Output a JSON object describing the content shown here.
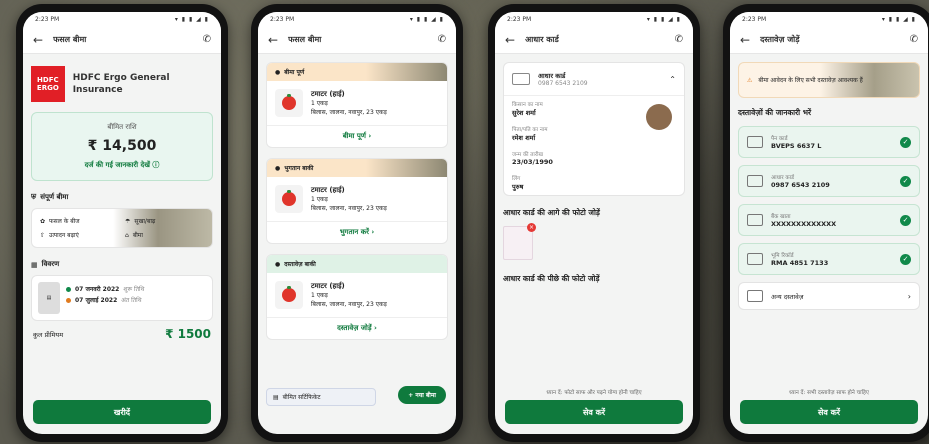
{
  "status": {
    "time": "2:23 PM",
    "icons": "▾ ▮ ▮ ◢ ▮"
  },
  "phone1": {
    "title": "फसल बीमा",
    "insurer_name": "HDFC Ergo General Insurance",
    "logo_text": "HDFC ERGO",
    "premium_label": "बीमित राशि",
    "premium_amount": "₹ 14,500",
    "premium_link": "दर्ज की गई जानकारी देखें ⓘ",
    "coverage_title": "संपूर्ण बीमा",
    "benefits": [
      "फसल के बीज",
      "सूखा/बाढ़",
      "उत्पादन बढ़ाएं",
      "बीमा"
    ],
    "timeline_title": "विवरण",
    "timeline": [
      {
        "date": "07 जनवरी 2022",
        "tag": "शुरू तिथि"
      },
      {
        "date": "07 जुलाई 2022",
        "tag": "अंत तिथि"
      }
    ],
    "total_label": "कुल प्रीमियम",
    "total_amount": "₹ 1500",
    "cta": "खरीदें"
  },
  "phone2": {
    "title": "फसल बीमा",
    "crops": [
      {
        "banner": "बीमा पूर्ण",
        "banner_color": "#fbe5c8",
        "name": "टमाटर (हाई)",
        "area": "1 एकड़",
        "location": "बिलास, जालना, नवापुर, 23 एकड़",
        "link": "बीमा पूर्ण ›"
      },
      {
        "banner": "भुगतान बाकी",
        "banner_color": "#fbe5c8",
        "name": "टमाटर (हाई)",
        "area": "1 एकड़",
        "location": "बिलास, जालना, नवापुर, 23 एकड़",
        "link": "भुगतान करें ›"
      },
      {
        "banner": "दस्तावेज़ बाकी",
        "banner_color": "#dff2e6",
        "name": "टमाटर (हाई)",
        "area": "1 एकड़",
        "location": "बिलास, जालना, नवापुर, 23 एकड़",
        "link": "दस्तावेज़ जोड़ें ›"
      }
    ],
    "certificate": "बीमित सर्टिफिकेट",
    "fab": "+ नया बीमा"
  },
  "phone3": {
    "title": "आधार कार्ड",
    "card_label": "आधार कार्ड",
    "card_number": "0987 6543 2109",
    "fields": [
      {
        "k": "किसान का नाम",
        "v": "सुरेश शर्मा"
      },
      {
        "k": "पिता/पति का नाम",
        "v": "रमेश शर्मा"
      },
      {
        "k": "जन्म की तारीख",
        "v": "23/03/1990"
      },
      {
        "k": "लिंग",
        "v": "पुरुष"
      }
    ],
    "front_title": "आधार कार्ड की आगे की फोटो जोड़ें",
    "back_title": "आधार कार्ड की पीछे की फोटो जोड़ें",
    "note": "ध्यान दें: फोटो साफ और पढ़ने योग्य होनी चाहिए",
    "cta": "सेव करें"
  },
  "phone4": {
    "title": "दस्तावेज़ जोड़ें",
    "banner": "बीमा आवेदन के लिए सभी दस्तावेज़ आवश्यक हैं",
    "section_title": "दस्तावेज़ों की जानकारी भरें",
    "docs": [
      {
        "k": "पैन कार्ड",
        "v": "BVEPS 6637 L"
      },
      {
        "k": "आधार कार्ड",
        "v": "0987 6543 2109"
      },
      {
        "k": "बैंक खाता",
        "v": "XXXXXXXXXXXXX"
      },
      {
        "k": "भूमि रिकॉर्ड",
        "v": "RMA 4851 7133"
      }
    ],
    "other": "अन्य दस्तावेज़",
    "note": "ध्यान दें: सभी दस्तावेज़ साफ होने चाहिए",
    "cta": "सेव करें"
  }
}
